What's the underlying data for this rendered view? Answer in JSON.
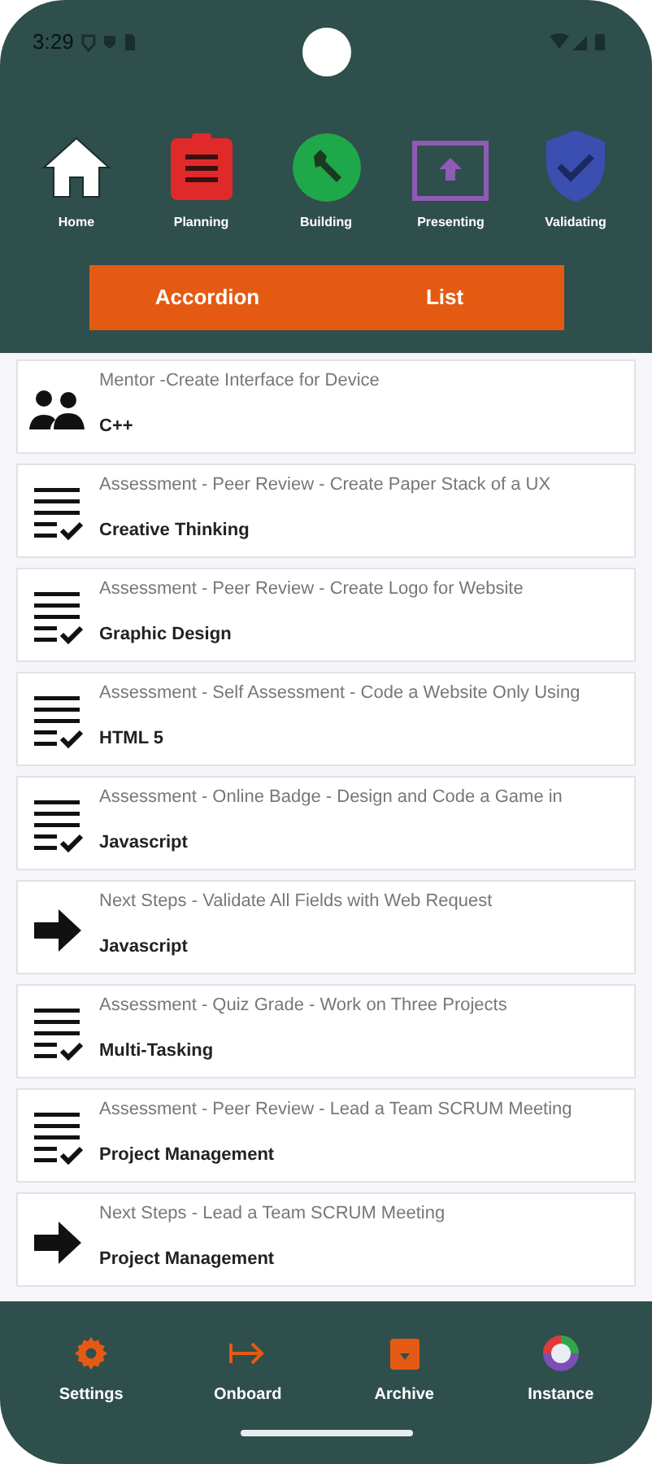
{
  "status_bar": {
    "time": "3:29"
  },
  "categories": [
    {
      "label": "Home",
      "kind": "home"
    },
    {
      "label": "Planning",
      "kind": "planning"
    },
    {
      "label": "Building",
      "kind": "building"
    },
    {
      "label": "Presenting",
      "kind": "presenting"
    },
    {
      "label": "Validating",
      "kind": "validating"
    }
  ],
  "view_toggle": [
    {
      "label": "Accordion"
    },
    {
      "label": "List"
    }
  ],
  "items": [
    {
      "kind": "mentor",
      "title": "Mentor -Create Interface for Device",
      "subtitle": "C++"
    },
    {
      "kind": "assessment",
      "title": "Assessment - Peer Review - Create Paper Stack of a UX",
      "subtitle": "Creative Thinking"
    },
    {
      "kind": "assessment",
      "title": "Assessment - Peer Review - Create Logo for Website",
      "subtitle": "Graphic Design"
    },
    {
      "kind": "assessment",
      "title": "Assessment - Self Assessment - Code a Website Only Using",
      "subtitle": "HTML 5"
    },
    {
      "kind": "assessment",
      "title": "Assessment - Online Badge - Design and Code a Game in",
      "subtitle": "Javascript"
    },
    {
      "kind": "next",
      "title": "Next Steps - Validate All Fields with Web Request",
      "subtitle": "Javascript"
    },
    {
      "kind": "assessment",
      "title": "Assessment - Quiz Grade - Work on Three Projects",
      "subtitle": "Multi-Tasking"
    },
    {
      "kind": "assessment",
      "title": "Assessment - Peer Review - Lead a Team SCRUM Meeting",
      "subtitle": "Project Management"
    },
    {
      "kind": "next",
      "title": "Next Steps - Lead a Team SCRUM Meeting",
      "subtitle": "Project Management"
    }
  ],
  "bottom_nav": [
    {
      "label": "Settings",
      "kind": "settings"
    },
    {
      "label": "Onboard",
      "kind": "onboard"
    },
    {
      "label": "Archive",
      "kind": "archive"
    },
    {
      "label": "Instance",
      "kind": "instance"
    }
  ]
}
